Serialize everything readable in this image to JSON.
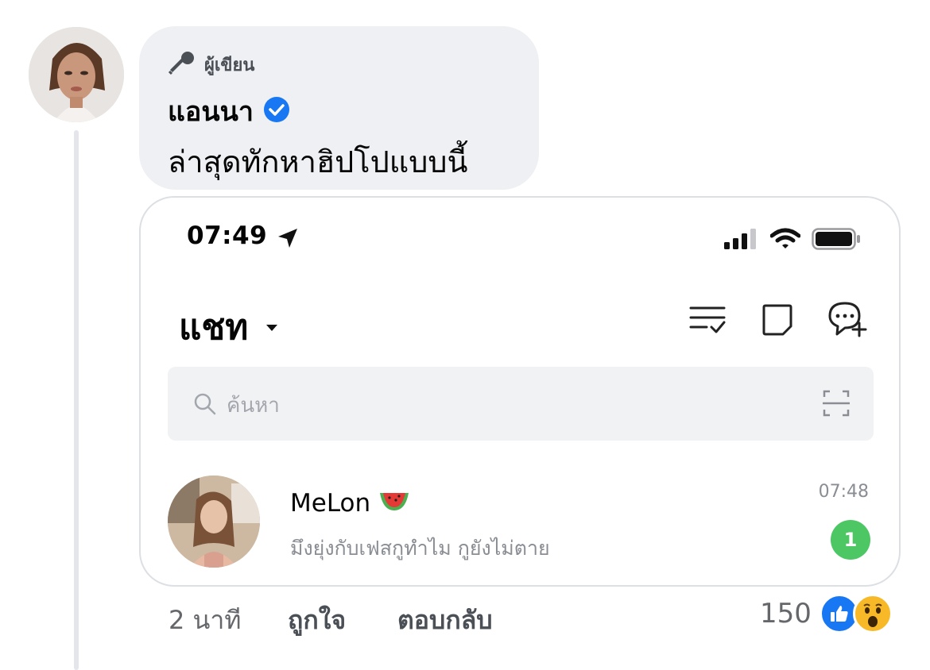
{
  "comment": {
    "author_badge": "ผู้เขียน",
    "author_name": "แอนนา",
    "text": "ล่าสุดทักหาฮิปโปแบบนี้",
    "timestamp": "2 นาที",
    "like_label": "ถูกใจ",
    "reply_label": "ตอบกลับ",
    "reaction_count": "150",
    "reactions": [
      "like-icon",
      "wow-icon"
    ],
    "verified_color": "#1877f2"
  },
  "screenshot": {
    "status_bar": {
      "time": "07:49",
      "icons": [
        "location-arrow-icon",
        "signal-icon",
        "wifi-icon",
        "battery-icon"
      ]
    },
    "header": {
      "title": "แชท",
      "icons": [
        "checklist-icon",
        "note-icon",
        "new-chat-icon"
      ]
    },
    "search": {
      "placeholder": "ค้นหา"
    },
    "chats": [
      {
        "name": "MeLon",
        "emoji": "🍉",
        "preview": "มึงยุ่งกับเฟสกูทำไม กูยังไม่ตาย",
        "time": "07:48",
        "unread": "1"
      }
    ],
    "unread_color": "#4cc764"
  }
}
